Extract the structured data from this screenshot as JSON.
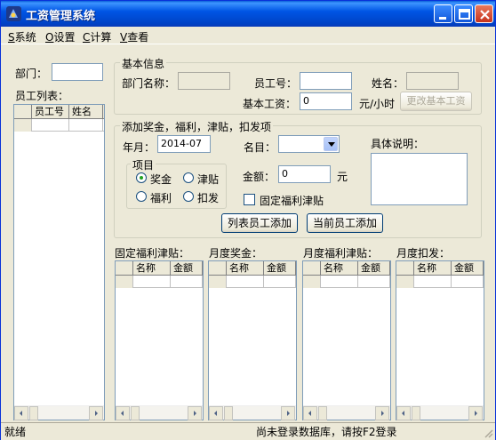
{
  "window": {
    "title": "工资管理系统"
  },
  "menu": {
    "items": [
      {
        "key": "S",
        "label": "系统"
      },
      {
        "key": "O",
        "label": "设置"
      },
      {
        "key": "C",
        "label": "计算"
      },
      {
        "key": "V",
        "label": "查看"
      }
    ]
  },
  "left": {
    "dept_label": "部门：",
    "dept_value": "",
    "list_label": "员工列表：",
    "columns": [
      "员工号",
      "姓名"
    ]
  },
  "basic": {
    "legend": "基本信息",
    "dept_name_label": "部门名称：",
    "emp_no_label": "员工号：",
    "name_label": "姓名：",
    "salary_label": "基本工资：",
    "salary_value": "0",
    "unit": "元/小时",
    "change_button": "更改基本工资"
  },
  "add": {
    "legend": "添加奖金，福利，津贴，扣发项",
    "year_month_label": "年月：",
    "year_month_value": "2014-07",
    "item_label": "名目：",
    "detail_label": "具体说明：",
    "group_label": "项目",
    "options": [
      "奖金",
      "津贴",
      "福利",
      "扣发"
    ],
    "selected": "奖金",
    "amount_label": "金额：",
    "amount_value": "0",
    "amount_unit": "元",
    "fixed_label": "固定福利津贴",
    "btn_list_add": "列表员工添加",
    "btn_current_add": "当前员工添加"
  },
  "grids": [
    {
      "title": "固定福利津贴：",
      "columns": [
        "名称",
        "金额"
      ]
    },
    {
      "title": "月度奖金：",
      "columns": [
        "名称",
        "金额"
      ]
    },
    {
      "title": "月度福利津贴：",
      "columns": [
        "名称",
        "金额"
      ]
    },
    {
      "title": "月度扣发：",
      "columns": [
        "名称",
        "金额"
      ]
    }
  ],
  "status": {
    "left": "就绪",
    "right": "尚未登录数据库，请按F2登录"
  }
}
